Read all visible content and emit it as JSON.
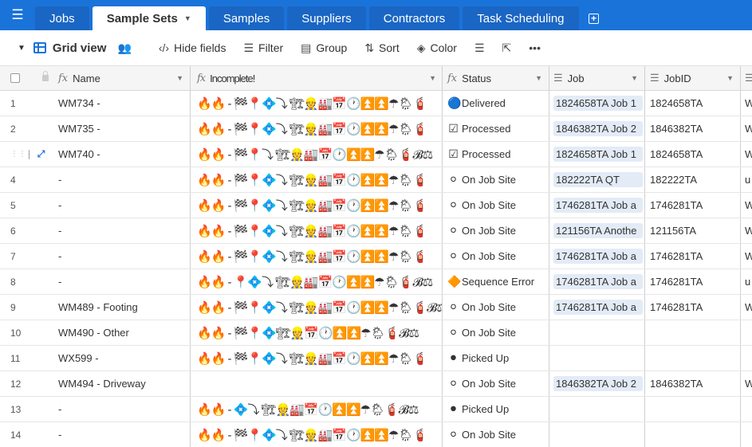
{
  "tabs": [
    {
      "label": "Jobs",
      "active": false
    },
    {
      "label": "Sample Sets",
      "active": true
    },
    {
      "label": "Samples",
      "active": false
    },
    {
      "label": "Suppliers",
      "active": false
    },
    {
      "label": "Contractors",
      "active": false
    },
    {
      "label": "Task Scheduling",
      "active": false
    }
  ],
  "toolbar": {
    "view_name": "Grid view",
    "hide_fields": "Hide fields",
    "filter": "Filter",
    "group": "Group",
    "sort": "Sort",
    "color": "Color"
  },
  "columns": {
    "name": "Name",
    "incomplete": "Incomplete!",
    "status": "Status",
    "job": "Job",
    "jobid": "JobID"
  },
  "status_colors": {
    "Delivered": "#1e63d6",
    "Processed": "#555555",
    "On Job Site": "#dddddd",
    "Sequence Error": "#f08a1c",
    "Picked Up": "#111111"
  },
  "rows": [
    {
      "num": "1",
      "name": "WM734 -",
      "incomplete": "🔥🔥 - 🏁📍💠⤵ 🏗👷🏭📅🕐⏫⏫☂🌦🧯",
      "status": "Delivered",
      "status_icon": "🔵",
      "job": "1824658TA Job 1",
      "jobid": "1824658TA",
      "more": "W"
    },
    {
      "num": "2",
      "name": "WM735 -",
      "incomplete": "🔥🔥 - 🏁📍💠⤵ 🏗👷🏭📅🕐⏫⏫☂🌦🧯",
      "status": "Processed",
      "status_icon": "☑",
      "job": "1846382TA Job 2",
      "jobid": "1846382TA",
      "more": "W"
    },
    {
      "num": "3",
      "name": "WM740 -",
      "incomplete": "🔥🔥 - 🏁📍⤵ 🏗👷🏭📅🕐⏫⏫☂🌦🧯𝓑⚖",
      "status": "Processed",
      "status_icon": "☑",
      "job": "1824658TA Job 1",
      "jobid": "1824658TA",
      "more": "W"
    },
    {
      "num": "4",
      "name": "-",
      "incomplete": "🔥🔥 - 🏁📍💠⤵ 🏗👷🏭📅🕐⏫⏫☂🌦🧯",
      "status": "On Job Site",
      "status_icon": "⚪",
      "job": "182222TA QT",
      "jobid": "182222TA",
      "more": "u"
    },
    {
      "num": "5",
      "name": "-",
      "incomplete": "🔥🔥 - 🏁📍💠⤵ 🏗👷🏭📅🕐⏫⏫☂🌦🧯",
      "status": "On Job Site",
      "status_icon": "⚪",
      "job": "1746281TA Job a",
      "jobid": "1746281TA",
      "more": "W"
    },
    {
      "num": "6",
      "name": "-",
      "incomplete": "🔥🔥 - 🏁📍💠⤵ 🏗👷🏭📅🕐⏫⏫☂🌦🧯",
      "status": "On Job Site",
      "status_icon": "⚪",
      "job": "121156TA Anothe",
      "jobid": "121156TA",
      "more": "W"
    },
    {
      "num": "7",
      "name": "-",
      "incomplete": "🔥🔥 - 🏁📍💠⤵ 🏗👷🏭📅🕐⏫⏫☂🌦🧯",
      "status": "On Job Site",
      "status_icon": "⚪",
      "job": "1746281TA Job a",
      "jobid": "1746281TA",
      "more": "W"
    },
    {
      "num": "8",
      "name": "-",
      "incomplete": "🔥🔥 - 📍💠⤵ 🏗👷🏭📅🕐⏫⏫☂🌦🧯𝓑⚖",
      "status": "Sequence Error",
      "status_icon": "🔶",
      "job": "1746281TA Job a",
      "jobid": "1746281TA",
      "more": "u"
    },
    {
      "num": "9",
      "name": "WM489 - Footing",
      "incomplete": "🔥🔥 - 🏁📍💠⤵ 🏗👷🏭📅🕐⏫⏫☂🌦🧯𝓑⚖",
      "status": "On Job Site",
      "status_icon": "⚪",
      "job": "1746281TA Job a",
      "jobid": "1746281TA",
      "more": "W"
    },
    {
      "num": "10",
      "name": "WM490 - Other",
      "incomplete": "🔥🔥 - 🏁📍💠🏗👷📅🕐⏫⏫☂🌦🧯𝓑⚖",
      "status": "On Job Site",
      "status_icon": "⚪",
      "job": "",
      "jobid": "",
      "more": ""
    },
    {
      "num": "11",
      "name": "WX599 -",
      "incomplete": "🔥🔥 - 🏁📍💠⤵ 🏗👷🏭📅🕐⏫⏫☂🌦🧯",
      "status": "Picked Up",
      "status_icon": "⚫",
      "job": "",
      "jobid": "",
      "more": ""
    },
    {
      "num": "12",
      "name": "WM494 - Driveway",
      "incomplete": "",
      "status": "On Job Site",
      "status_icon": "⚪",
      "job": "1846382TA Job 2",
      "jobid": "1846382TA",
      "more": "W"
    },
    {
      "num": "13",
      "name": "-",
      "incomplete": "🔥🔥 - 💠⤵ 🏗👷🏭📅🕐⏫⏫☂🌦🧯𝓑⚖",
      "status": "Picked Up",
      "status_icon": "⚫",
      "job": "",
      "jobid": "",
      "more": ""
    },
    {
      "num": "14",
      "name": "-",
      "incomplete": "🔥🔥 - 🏁📍💠⤵ 🏗👷🏭📅🕐⏫⏫☂🌦🧯",
      "status": "On Job Site",
      "status_icon": "⚪",
      "job": "",
      "jobid": "",
      "more": ""
    }
  ]
}
